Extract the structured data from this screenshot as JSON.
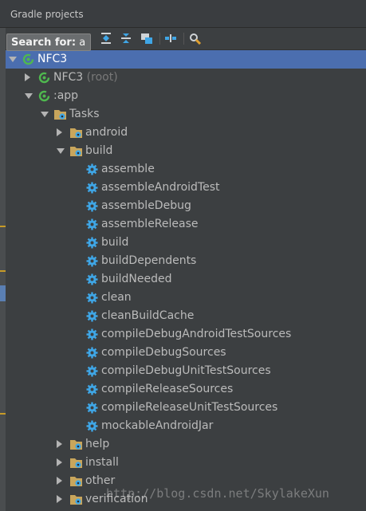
{
  "window": {
    "title": "Gradle projects"
  },
  "search": {
    "prefix": "Search for:",
    "query": "a"
  },
  "toolbar": {
    "icons": [
      "refresh-all-icon",
      "add-project-icon",
      "execute-task-icon",
      "expand-all-icon",
      "collapse-all-icon",
      "group-modules-icon",
      "offline-mode-icon",
      "gradle-settings-icon"
    ]
  },
  "tree": {
    "root": "NFC3",
    "nfc3_module": {
      "name": "NFC3",
      "suffix": "(root)"
    },
    "app_module": ":app",
    "tasks": "Tasks",
    "android": "android",
    "build": "build",
    "build_tasks": [
      "assemble",
      "assembleAndroidTest",
      "assembleDebug",
      "assembleRelease",
      "build",
      "buildDependents",
      "buildNeeded",
      "clean",
      "cleanBuildCache",
      "compileDebugAndroidTestSources",
      "compileDebugSources",
      "compileDebugUnitTestSources",
      "compileReleaseSources",
      "compileReleaseUnitTestSources",
      "mockableAndroidJar"
    ],
    "groups_after": [
      "help",
      "install",
      "other",
      "verification"
    ]
  },
  "watermark": "http://blog.csdn.net/SkylakeXun",
  "colors": {
    "selection": "#4b6eaf",
    "gear": "#3fa6e6",
    "folder": "#c9a65c",
    "gradle_green": "#4fb84f"
  }
}
